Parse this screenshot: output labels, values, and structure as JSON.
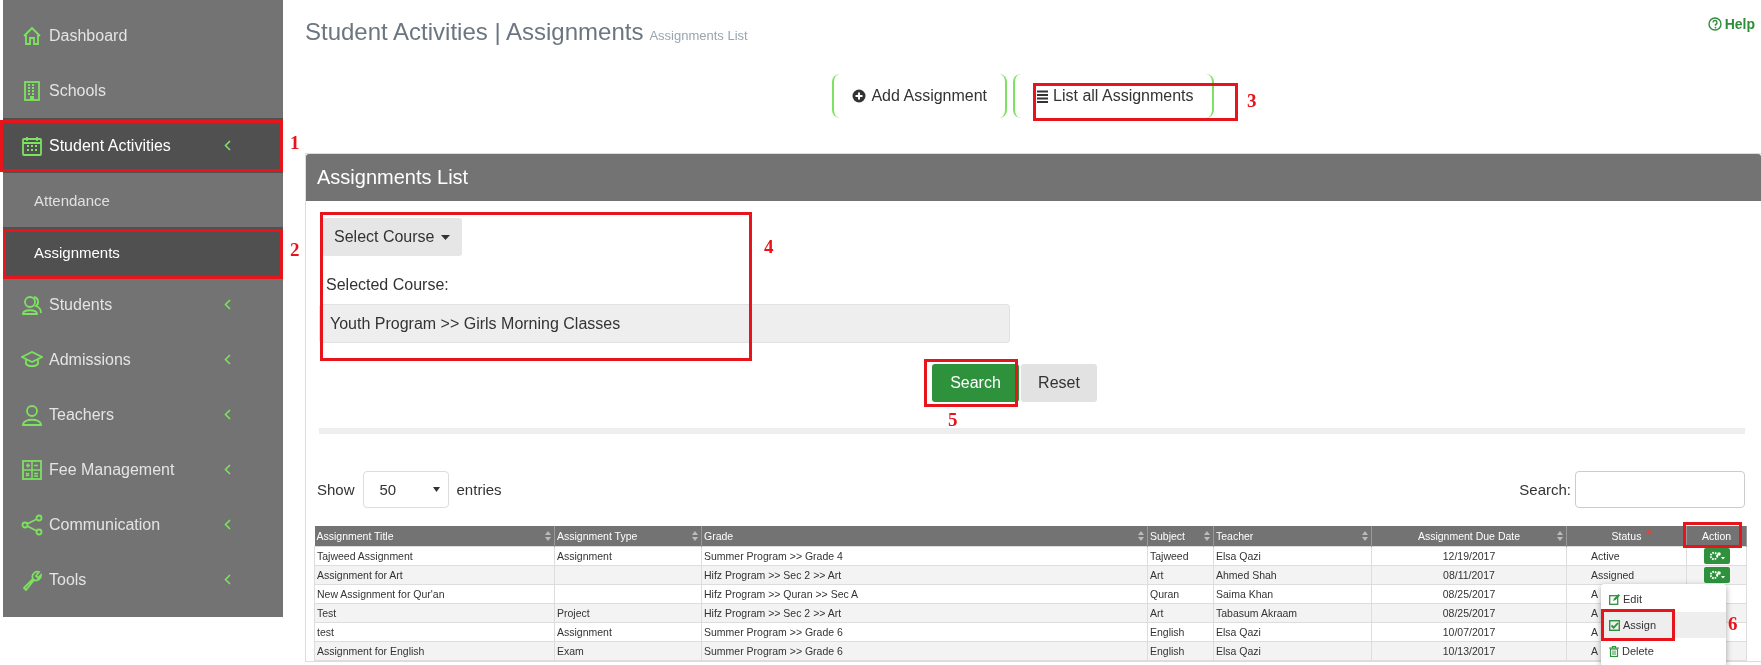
{
  "sidebar": {
    "items": [
      {
        "label": "Dashboard",
        "kind": "link",
        "selected": false
      },
      {
        "label": "Schools",
        "kind": "link",
        "selected": false
      },
      {
        "label": "Student Activities",
        "kind": "group",
        "selected": true,
        "children": [
          {
            "label": "Attendance",
            "selected": false
          },
          {
            "label": "Assignments",
            "selected": true
          }
        ]
      },
      {
        "label": "Students",
        "kind": "group",
        "selected": false
      },
      {
        "label": "Admissions",
        "kind": "group",
        "selected": false
      },
      {
        "label": "Teachers",
        "kind": "group",
        "selected": false
      },
      {
        "label": "Fee Management",
        "kind": "group",
        "selected": false
      },
      {
        "label": "Communication",
        "kind": "group",
        "selected": false
      },
      {
        "label": "Tools",
        "kind": "group",
        "selected": false
      }
    ]
  },
  "header": {
    "title": "Student Activities | Assignments",
    "subtitle": "Assignments List",
    "help": "Help"
  },
  "actions": [
    "Add Assignment",
    "List all Assignments"
  ],
  "panel": {
    "title": "Assignments List",
    "select_button": "Select Course",
    "selected_label": "Selected Course:",
    "selected_value": "Youth Program >> Girls Morning Classes",
    "search_button": "Search",
    "reset_button": "Reset"
  },
  "entries": {
    "show": "Show",
    "value": "50",
    "suffix": "entries",
    "search_label": "Search:"
  },
  "table": {
    "columns": [
      {
        "label": "Assignment Title",
        "sortable": true,
        "sorted": false
      },
      {
        "label": "Assignment Type",
        "sortable": true,
        "sorted": false
      },
      {
        "label": "Grade",
        "sortable": true,
        "sorted": false
      },
      {
        "label": "Subject",
        "sortable": true,
        "sorted": false
      },
      {
        "label": "Teacher",
        "sortable": true,
        "sorted": false
      },
      {
        "label": "Assignment Due Date",
        "sortable": true,
        "sorted": false
      },
      {
        "label": "Status",
        "sortable": true,
        "sorted": true
      },
      {
        "label": "Action",
        "sortable": false
      }
    ],
    "rows": [
      {
        "cells": [
          "Tajweed Assignment",
          "Assignment",
          "Summer Program >> Grade 4",
          "Tajweed",
          "Elsa Qazi",
          "12/19/2017",
          "Active"
        ],
        "action_button": true
      },
      {
        "cells": [
          "Assignment for Art",
          "",
          "Hifz Program >> Sec 2 >> Art",
          "Art",
          "Ahmed Shah",
          "08/11/2017",
          "Assigned"
        ],
        "action_button": true
      },
      {
        "cells": [
          "New Assignment for Qur'an",
          "",
          "Hifz Program >> Quran >> Sec A",
          "Quran",
          "Saima Khan",
          "08/25/2017",
          "A"
        ],
        "action_button": false
      },
      {
        "cells": [
          "Test",
          "Project",
          "Hifz Program >> Sec 2 >> Art",
          "Art",
          "Tabasum Akraam",
          "08/25/2017",
          "A"
        ],
        "action_button": false
      },
      {
        "cells": [
          "test",
          "Assignment",
          "Summer Program >> Grade 6",
          "English",
          "Elsa Qazi",
          "10/07/2017",
          "A"
        ],
        "action_button": false
      },
      {
        "cells": [
          "Assignment for English",
          "Exam",
          "Summer Program >> Grade 6",
          "English",
          "Elsa Qazi",
          "10/13/2017",
          "A"
        ],
        "action_button": false
      }
    ],
    "menu": [
      {
        "label": "Edit",
        "selected": false
      },
      {
        "label": "Assign",
        "selected": true
      },
      {
        "label": "Delete",
        "selected": false
      }
    ]
  },
  "annotations": [
    {
      "kind": "numbered",
      "label": "1"
    },
    {
      "kind": "numbered",
      "label": "2"
    },
    {
      "kind": "numbered",
      "label": "3"
    },
    {
      "kind": "numbered",
      "label": "4"
    },
    {
      "kind": "numbered",
      "label": "5"
    },
    {
      "kind": "numbered",
      "label": "6"
    },
    {
      "kind": "box"
    }
  ]
}
